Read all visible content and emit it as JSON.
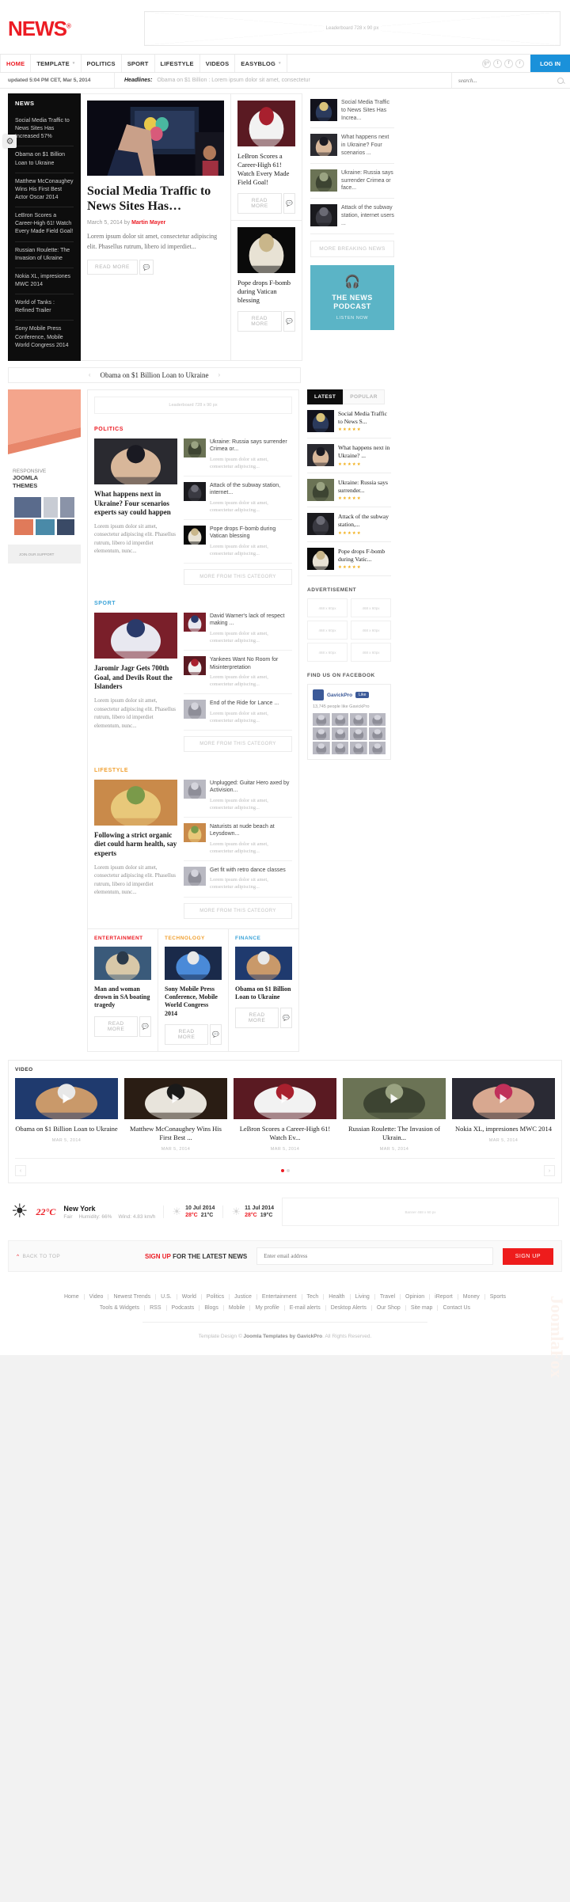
{
  "site": {
    "logo": "NEWS",
    "logo_sup": "®"
  },
  "leaderboard": {
    "label": "Leaderboard  728 x 90 px"
  },
  "nav": {
    "items": [
      {
        "label": "HOME",
        "caret": false
      },
      {
        "label": "TEMPLATE",
        "caret": true
      },
      {
        "label": "POLITICS",
        "caret": false
      },
      {
        "label": "SPORT",
        "caret": false
      },
      {
        "label": "LIFESTYLE",
        "caret": false
      },
      {
        "label": "VIDEOS",
        "caret": false
      },
      {
        "label": "EASYBLOG",
        "caret": true
      }
    ],
    "social": [
      "g+",
      "t",
      "f",
      "r"
    ],
    "login": "LOG IN"
  },
  "subbar": {
    "updated": "updated 5:04 PM CET, Mar 5, 2014",
    "headlines_label": "Headlines:",
    "headlines_text": "Obama on $1 Billion : Lorem ipsum dolor sit amet, consectetur",
    "search_placeholder": "search..."
  },
  "news_column": {
    "title": "NEWS",
    "items": [
      "Social Media Traffic to News Sites Has Increased 57%",
      "Obama on $1 Billion Loan to Ukraine",
      "Matthew McConaughey Wins His First Best Actor Oscar 2014",
      "LeBron Scores a Career-High 61! Watch Every Made Field Goal!",
      "Russian Roulette: The Invasion of Ukraine",
      "Nokia XL, impresiones MWC 2014",
      "World of Tanks : Refined Trailer",
      "Sony Mobile Press Conference, Mobile World Congress 2014"
    ]
  },
  "feature": {
    "title": "Social Media Traffic to News Sites Has…",
    "date": "March 5, 2014",
    "by_label": "by",
    "author": "Martin Mayer",
    "text": "Lorem ipsum dolor sit amet, consectetur adipiscing elit. Phasellus rutrum, libero id imperdiet...",
    "read_more": "READ MORE"
  },
  "mid_column": {
    "items": [
      {
        "title": "LeBron Scores a Career-High 61! Watch Every Made Field Goal!",
        "read_more": "READ MORE"
      },
      {
        "title": "Pope drops F-bomb during Vatican blessing",
        "read_more": "READ MORE"
      }
    ]
  },
  "breaking": {
    "items": [
      "Social Media Traffic to News Sites Has Increa...",
      "What happens next in Ukraine? Four scenarios ...",
      "Ukraine: Russia says surrender Crimea or face...",
      "Attack of the subway station, internet users ..."
    ],
    "more": "MORE BREAKING NEWS"
  },
  "podcast": {
    "title": "THE NEWS PODCAST",
    "listen": "LISTEN NOW"
  },
  "slider_strip": {
    "title": "Obama on $1 Billion Loan to Ukraine",
    "prev": "‹",
    "next": "›"
  },
  "left_ad": {
    "line1": "RESPONSIVE",
    "line2": "JOOMLA",
    "line3": "THEMES",
    "footer": "JOIN.OUR.SUPPORT"
  },
  "inner_leaderboard": {
    "label": "Leaderboard  728 x 90 px"
  },
  "categories": [
    {
      "name": "POLITICS",
      "class": "cat-politics",
      "main": {
        "title": "What happens next in Ukraine? Four scenarios experts say could happen",
        "text": "Lorem ipsum dolor sit amet, consectetur adipiscing elit. Phasellus rutrum, libero id imperdiet elementum, nunc..."
      },
      "list": [
        {
          "title": "Ukraine: Russia says surrender Crimea or...",
          "desc": "Lorem ipsum dolor sit amet, consectetur adipiscing..."
        },
        {
          "title": "Attack of the subway station, internet...",
          "desc": "Lorem ipsum dolor sit amet, consectetur adipiscing..."
        },
        {
          "title": "Pope drops F-bomb during Vatican blessing",
          "desc": "Lorem ipsum dolor sit amet, consectetur adipiscing..."
        }
      ],
      "more": "MORE FROM THIS CATEGORY"
    },
    {
      "name": "SPORT",
      "class": "cat-sport",
      "main": {
        "title": "Jaromir Jagr Gets 700th Goal, and Devils Rout the Islanders",
        "text": "Lorem ipsum dolor sit amet, consectetur adipiscing elit. Phasellus rutrum, libero id imperdiet elementum, nunc..."
      },
      "list": [
        {
          "title": "David Warner's lack of respect making ...",
          "desc": "Lorem ipsum dolor sit amet, consectetur adipiscing..."
        },
        {
          "title": "Yankees Want No Room for Misinterpretation",
          "desc": "Lorem ipsum dolor sit amet, consectetur adipiscing..."
        },
        {
          "title": "End of the Ride for Lance ...",
          "desc": "Lorem ipsum dolor sit amet, consectetur adipiscing..."
        }
      ],
      "more": "MORE FROM THIS CATEGORY"
    },
    {
      "name": "LIFESTYLE",
      "class": "cat-lifestyle",
      "main": {
        "title": "Following a strict organic diet could harm health, say experts",
        "text": "Lorem ipsum dolor sit amet, consectetur adipiscing elit. Phasellus rutrum, libero id imperdiet elementum, nunc..."
      },
      "list": [
        {
          "title": "Unplugged: Guitar Hero axed by Activision...",
          "desc": "Lorem ipsum dolor sit amet, consectetur adipiscing..."
        },
        {
          "title": "Naturists at nude beach at Leysdown...",
          "desc": "Lorem ipsum dolor sit amet, consectetur adipiscing..."
        },
        {
          "title": "Get fit with retro dance classes",
          "desc": "Lorem ipsum dolor sit amet, consectetur adipiscing..."
        }
      ],
      "more": "MORE FROM THIS CATEGORY"
    }
  ],
  "bottom_blocks": [
    {
      "head": "ENTERTAINMENT",
      "head_class": "cat-politics",
      "title": "Man and woman drown in SA boating tragedy",
      "read_more": "READ MORE"
    },
    {
      "head": "TECHNOLOGY",
      "head_class": "cat-lifestyle",
      "title": "Sony Mobile Press Conference, Mobile World Congress 2014",
      "read_more": "READ MORE"
    },
    {
      "head": "FINANCE",
      "head_class": "cat-sport",
      "title": "Obama on $1 Billion Loan to Ukraine",
      "read_more": "READ MORE"
    }
  ],
  "sidebar": {
    "tabs": [
      {
        "label": "LATEST",
        "active": true
      },
      {
        "label": "POPULAR",
        "active": false
      }
    ],
    "items": [
      {
        "title": "Social Media Traffic to News S...",
        "stars": "★★★★★"
      },
      {
        "title": "What happens next in Ukraine? ...",
        "stars": "★★★★★"
      },
      {
        "title": "Ukraine: Russia says surrender...",
        "stars": "★★★★★"
      },
      {
        "title": "Attack of the subway station,...",
        "stars": "★★★★★"
      },
      {
        "title": "Pope drops F-bomb during Vatic...",
        "stars": "★★★★★"
      }
    ],
    "advertisement_head": "ADVERTISEMENT",
    "ad_cells": [
      "468 x 60px",
      "468 x 60px",
      "468 x 60px",
      "468 x 60px",
      "468 x 60px",
      "468 x 60px"
    ],
    "facebook_head": "FIND US ON FACEBOOK",
    "fb_name": "GavickPro",
    "fb_like": "Like",
    "fb_count": "13,745 people like GavickPro"
  },
  "video": {
    "head": "VIDEO",
    "items": [
      {
        "title": "Obama on $1 Billion Loan to Ukraine",
        "date": "MAR 5, 2014"
      },
      {
        "title": "Matthew McConaughey Wins His First Best ...",
        "date": "MAR 5, 2014"
      },
      {
        "title": "LeBron Scores a Career-High 61! Watch Ev...",
        "date": "MAR 5, 2014"
      },
      {
        "title": "Russian Roulette: The Invasion of Ukrain...",
        "date": "MAR 5, 2014"
      },
      {
        "title": "Nokia XL, impresiones MWC 2014",
        "date": "MAR 5, 2014"
      }
    ],
    "prev": "‹",
    "next": "›"
  },
  "weather": {
    "temp": "22°C",
    "city": "New York",
    "condition": "Fair",
    "humidity": "Humidity: 66%",
    "wind": "Wind: 4.83 km/h",
    "forecast": [
      {
        "date": "10 Jul 2014",
        "hi": "28°C",
        "lo": "21°C"
      },
      {
        "date": "11 Jul 2014",
        "hi": "28°C",
        "lo": "19°C"
      }
    ],
    "ad": "Banner 468 x 60 px"
  },
  "signup": {
    "back_to_top": "BACK TO TOP",
    "label_red": "SIGN UP",
    "label_rest": " FOR THE LATEST NEWS",
    "placeholder": "Enter email address",
    "button": "SIGN UP"
  },
  "footer": {
    "row1": [
      "Home",
      "Video",
      "Newest Trends",
      "U.S.",
      "World",
      "Politics",
      "Justice",
      "Entertainment",
      "Tech",
      "Health",
      "Living",
      "Travel",
      "Opinion",
      "iReport",
      "Money",
      "Sports"
    ],
    "row2": [
      "Tools & Widgets",
      "RSS",
      "Podcasts",
      "Blogs",
      "Mobile",
      "My profile",
      "E-mail alerts",
      "Desktop Alerts",
      "Our Shop",
      "Site map",
      "Contact Us"
    ],
    "copy_pre": "Template Design © ",
    "copy_strong": "Joomla Templates by GavickPro",
    "copy_post": ". All Rights Reserved.",
    "watermark": "JoomlaFox"
  }
}
